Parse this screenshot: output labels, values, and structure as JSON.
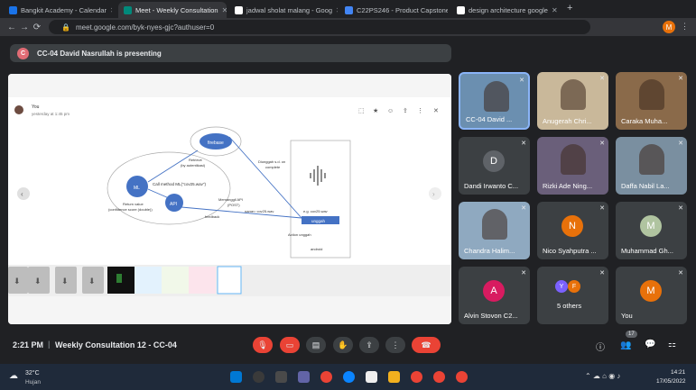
{
  "tabs": [
    {
      "label": "Bangkit Academy - Calendar",
      "color": "#1a73e8"
    },
    {
      "label": "Meet - Weekly Consultation",
      "color": "#00897b"
    },
    {
      "label": "jadwal sholat malang - Goog",
      "color": "#ffffff"
    },
    {
      "label": "C22PS246 - Product Capstone",
      "color": "#4285f4"
    },
    {
      "label": "design architecture google",
      "color": "#ffffff"
    }
  ],
  "url": "meet.google.com/byk-nyes-gjc?authuser=0",
  "profile_initial": "M",
  "presenting": {
    "initial": "C",
    "text": "CC-04 David Nasrullah is presenting"
  },
  "slide": {
    "author": "You",
    "time": "yesterday at 1:45 pm",
    "firebase": "firebase",
    "ml": "ML",
    "api": "API",
    "retrieve": "Retrieve\n(by autentikasi)",
    "call": "Call method ML(\"cov25.wav\")",
    "return": "Return value\n(confidence score (double))",
    "post": "Memanggil API\n(POST)",
    "name": "name= cov25.wav",
    "upload_firebase": "Diunggah s.d. on\ncomplete",
    "feedback": "feedback",
    "eg": "e.g. cov25.wav",
    "unggah": "unggah",
    "action": "Action unggah",
    "android": "android"
  },
  "participants": [
    {
      "name": "CC-04 David ...",
      "type": "video",
      "bg": "#6b8fb0"
    },
    {
      "name": "Anugerah Chri...",
      "type": "video",
      "bg": "#c9b89a"
    },
    {
      "name": "Caraka Muha...",
      "type": "video",
      "bg": "#8a6a4a"
    },
    {
      "name": "Dandi Irwanto C...",
      "type": "avatar",
      "initial": "D",
      "color": "#5f6368"
    },
    {
      "name": "Rizki Ade Ning...",
      "type": "video",
      "bg": "#6a5f7a"
    },
    {
      "name": "Daffa Nabil La...",
      "type": "video",
      "bg": "#7a8fa0"
    },
    {
      "name": "Chandra Halim...",
      "type": "video",
      "bg": "#8fa9c0"
    },
    {
      "name": "Nico Syahputra ...",
      "type": "avatar",
      "initial": "N",
      "color": "#e8710a"
    },
    {
      "name": "Muhammad Gh...",
      "type": "avatar",
      "initial": "M",
      "color": "#b0c4a0"
    },
    {
      "name": "Alvin Stovon C2...",
      "type": "avatar",
      "initial": "A",
      "color": "#d81b60"
    },
    {
      "name": "5 others",
      "type": "others",
      "i1": "Y",
      "i2": "F"
    },
    {
      "name": "You",
      "type": "avatar",
      "initial": "M",
      "color": "#e8710a"
    }
  ],
  "meeting": {
    "time": "2:21 PM",
    "title": "Weekly Consultation 12 - CC-04",
    "people_count": "17"
  },
  "taskbar": {
    "temp": "32°C",
    "weather": "Hujan",
    "clock": "14:21",
    "date": "17/05/2022"
  }
}
